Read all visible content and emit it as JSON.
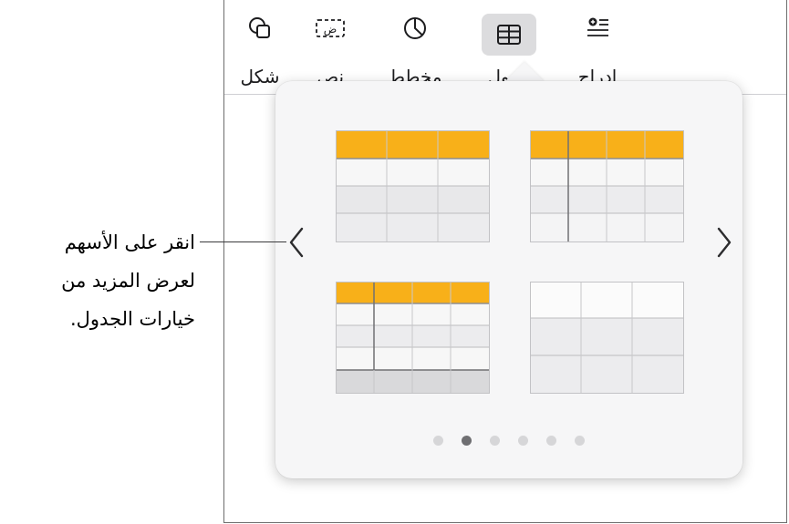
{
  "toolbar": {
    "items": [
      {
        "label": "إدراج",
        "icon": "insert-list-icon"
      },
      {
        "label": "جدول",
        "icon": "table-icon",
        "selected": true
      },
      {
        "label": "مخطط",
        "icon": "chart-icon"
      },
      {
        "label": "نص",
        "icon": "text-box-icon"
      },
      {
        "label": "شكل",
        "icon": "shape-icon"
      }
    ],
    "text_box_glyph": "ض"
  },
  "popover": {
    "page_index": 2,
    "page_count": 6,
    "header_color": "#F8B019"
  },
  "callout": {
    "lines": [
      "انقر على الأسهم",
      "لعرض المزيد من",
      "خيارات الجدول."
    ]
  }
}
